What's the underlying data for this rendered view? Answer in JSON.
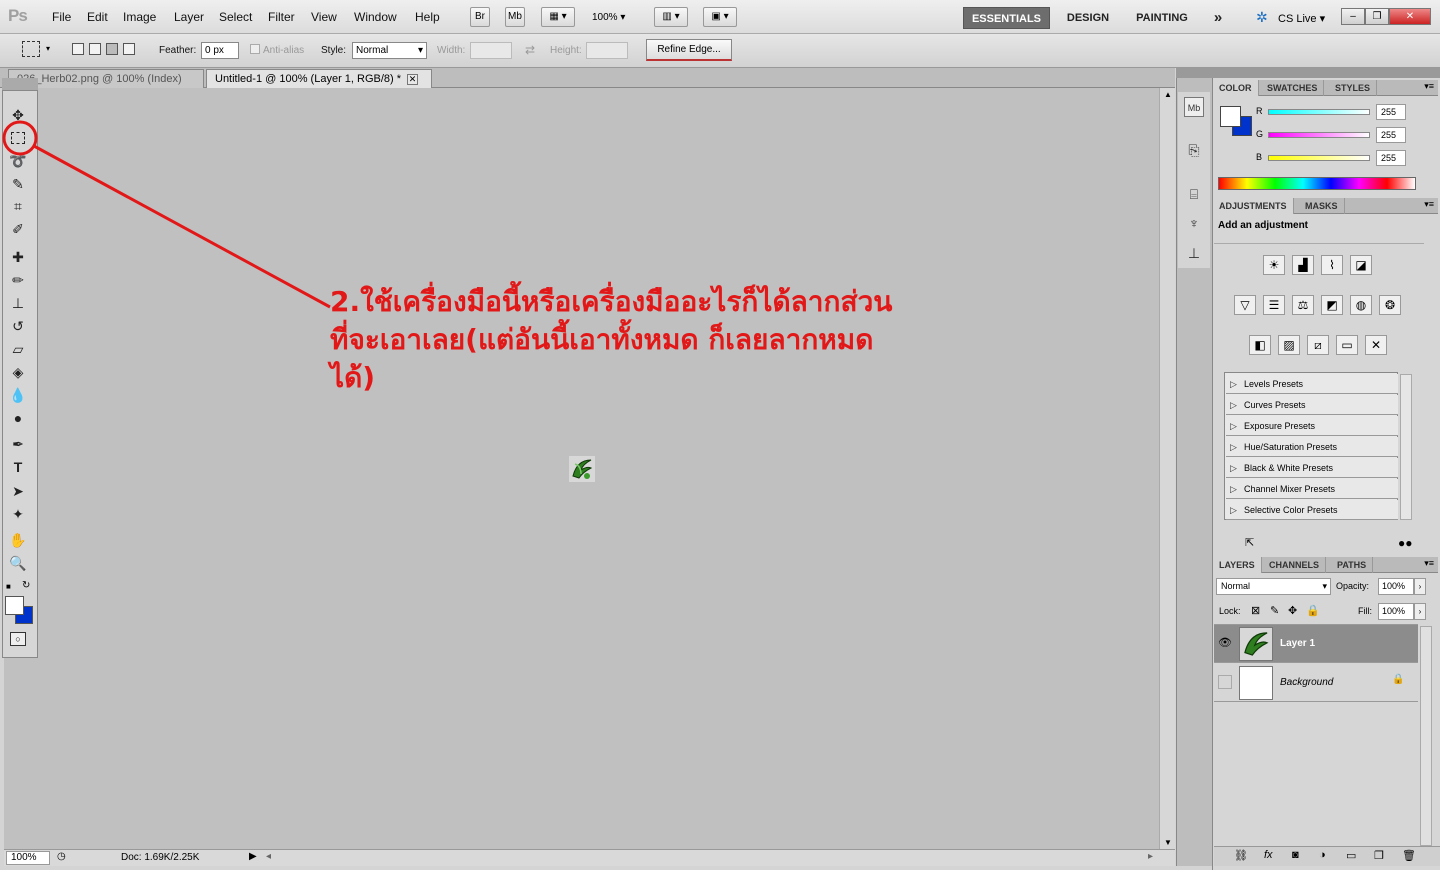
{
  "menubar": {
    "logo": "Ps",
    "items": [
      "File",
      "Edit",
      "Image",
      "Layer",
      "Select",
      "Filter",
      "View",
      "Window",
      "Help"
    ],
    "bridge": "Br",
    "minibridge": "Mb",
    "zoom": "100%",
    "workspaces": [
      "ESSENTIALS",
      "DESIGN",
      "PAINTING"
    ],
    "more": "»",
    "cslive": "CS Live"
  },
  "options": {
    "feather_label": "Feather:",
    "feather_value": "0 px",
    "antialias": "Anti-alias",
    "style_label": "Style:",
    "style_value": "Normal",
    "width_label": "Width:",
    "height_label": "Height:",
    "refine_edge": "Refine Edge..."
  },
  "tabs": [
    {
      "label": "026_Herb02.png @ 100% (Index)"
    },
    {
      "label": "Untitled-1 @ 100% (Layer 1, RGB/8) *"
    }
  ],
  "annotation": {
    "line1": "2.ใช้เครื่องมือนี้หรือเครื่องมืออะไรก็ได้ลากส่วน",
    "line2": "ที่จะเอาเลย(แต่อันนี้เอาทั้งหมด ก็เลยลากหมด",
    "line3": "ได้)"
  },
  "status": {
    "zoom": "100%",
    "doc": "Doc: 1.69K/2.25K"
  },
  "color_panel": {
    "tabs": [
      "COLOR",
      "SWATCHES",
      "STYLES"
    ],
    "channels": [
      {
        "label": "R",
        "value": "255"
      },
      {
        "label": "G",
        "value": "255"
      },
      {
        "label": "B",
        "value": "255"
      }
    ]
  },
  "adjustments_panel": {
    "tabs": [
      "ADJUSTMENTS",
      "MASKS"
    ],
    "heading": "Add an adjustment",
    "presets": [
      "Levels Presets",
      "Curves Presets",
      "Exposure Presets",
      "Hue/Saturation Presets",
      "Black & White Presets",
      "Channel Mixer Presets",
      "Selective Color Presets"
    ]
  },
  "layers_panel": {
    "tabs": [
      "LAYERS",
      "CHANNELS",
      "PATHS"
    ],
    "blend": "Normal",
    "opacity_label": "Opacity:",
    "opacity": "100%",
    "lock_label": "Lock:",
    "fill_label": "Fill:",
    "fill": "100%",
    "layers": [
      {
        "name": "Layer 1"
      },
      {
        "name": "Background"
      }
    ]
  },
  "colors": {
    "annotation_red": "#e21818",
    "background_color": "#0033cc"
  }
}
